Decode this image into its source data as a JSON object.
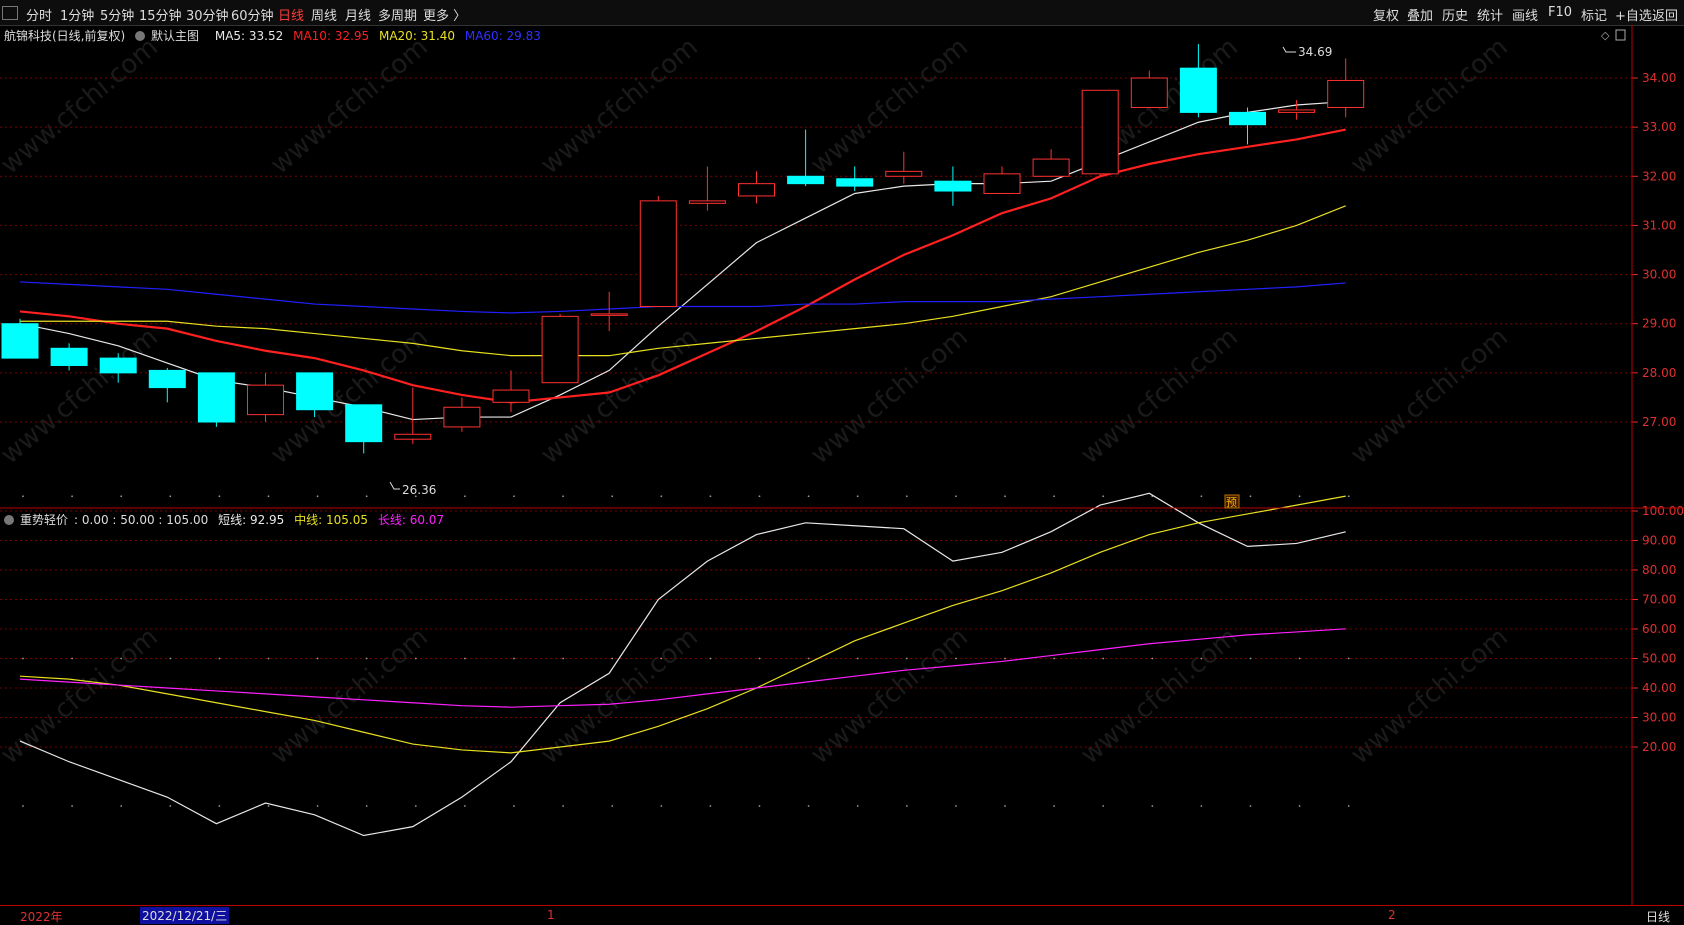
{
  "toolbar": {
    "left_items": [
      "分时",
      "1分钟",
      "5分钟",
      "15分钟",
      "30分钟",
      "60分钟",
      "日线",
      "周线",
      "月线",
      "多周期",
      "更多 〉"
    ],
    "active_item": "日线",
    "right_items": [
      "复权",
      "叠加",
      "历史",
      "统计",
      "画线",
      "F10",
      "标记",
      "+自选",
      "返回"
    ]
  },
  "main_chart": {
    "title": "航锦科技(日线,前复权)",
    "template": "默认主图",
    "ma5_label": "MA5: 33.52",
    "ma10_label": "MA10: 32.95",
    "ma20_label": "MA20: 31.40",
    "ma60_label": "MA60: 29.83",
    "high_label": "34.69",
    "low_label": "26.36",
    "predict_label": "预"
  },
  "sub_chart": {
    "title": "重势轻价",
    "levels_label": ": 0.00 : 50.00 : 105.00",
    "short_label": "短线: 92.95",
    "mid_label": "中线: 105.05",
    "long_label": "长线: 60.07"
  },
  "bottom_bar": {
    "year_label": "2022年",
    "date_label": "2022/12/21/三",
    "mark1": "1",
    "mark2": "2",
    "period_label": "日线"
  },
  "watermark": "www.cfchi.com",
  "colors": {
    "up": "#ff3030",
    "down": "#00ffff",
    "ma5": "#e8e8e8",
    "ma10": "#ff2020",
    "ma20": "#e8e020",
    "ma60": "#2020ff",
    "long": "#ff20ff",
    "grid": "#7a0000",
    "axis": "#e03030"
  },
  "chart_data": [
    {
      "type": "candlestick",
      "ylim": [
        26.0,
        35.0
      ],
      "yticks": [
        27.0,
        28.0,
        29.0,
        30.0,
        31.0,
        32.0,
        33.0,
        34.0
      ],
      "candles": [
        {
          "o": 29.0,
          "c": 28.3,
          "h": 29.1,
          "l": 28.3
        },
        {
          "o": 28.5,
          "c": 28.15,
          "h": 28.6,
          "l": 28.05
        },
        {
          "o": 28.3,
          "c": 28.0,
          "h": 28.4,
          "l": 27.8
        },
        {
          "o": 28.05,
          "c": 27.7,
          "h": 28.1,
          "l": 27.4
        },
        {
          "o": 28.0,
          "c": 27.0,
          "h": 28.0,
          "l": 26.9
        },
        {
          "o": 27.15,
          "c": 27.75,
          "h": 28.0,
          "l": 27.0
        },
        {
          "o": 28.0,
          "c": 27.25,
          "h": 28.0,
          "l": 27.1
        },
        {
          "o": 27.35,
          "c": 26.6,
          "h": 27.35,
          "l": 26.36
        },
        {
          "o": 26.65,
          "c": 26.75,
          "h": 27.7,
          "l": 26.55
        },
        {
          "o": 26.9,
          "c": 27.3,
          "h": 27.5,
          "l": 26.8
        },
        {
          "o": 27.4,
          "c": 27.65,
          "h": 28.05,
          "l": 27.2
        },
        {
          "o": 27.8,
          "c": 29.15,
          "h": 29.2,
          "l": 27.8
        },
        {
          "o": 29.2,
          "c": 29.2,
          "h": 29.65,
          "l": 28.85
        },
        {
          "o": 29.35,
          "c": 31.5,
          "h": 31.6,
          "l": 29.35
        },
        {
          "o": 31.45,
          "c": 31.5,
          "h": 32.2,
          "l": 31.3
        },
        {
          "o": 31.6,
          "c": 31.85,
          "h": 32.1,
          "l": 31.45
        },
        {
          "o": 32.0,
          "c": 31.85,
          "h": 32.95,
          "l": 31.8
        },
        {
          "o": 31.95,
          "c": 31.8,
          "h": 32.2,
          "l": 31.7
        },
        {
          "o": 32.0,
          "c": 32.1,
          "h": 32.5,
          "l": 31.85
        },
        {
          "o": 31.9,
          "c": 31.7,
          "h": 32.2,
          "l": 31.4
        },
        {
          "o": 31.65,
          "c": 32.05,
          "h": 32.2,
          "l": 31.65
        },
        {
          "o": 32.0,
          "c": 32.35,
          "h": 32.55,
          "l": 32.0
        },
        {
          "o": 32.05,
          "c": 33.75,
          "h": 33.75,
          "l": 32.0
        },
        {
          "o": 33.4,
          "c": 34.0,
          "h": 34.15,
          "l": 33.4
        },
        {
          "o": 34.2,
          "c": 33.3,
          "h": 34.69,
          "l": 33.2
        },
        {
          "o": 33.3,
          "c": 33.05,
          "h": 33.4,
          "l": 32.65
        },
        {
          "o": 33.3,
          "c": 33.35,
          "h": 33.55,
          "l": 33.15
        },
        {
          "o": 33.4,
          "c": 33.95,
          "h": 34.4,
          "l": 33.2
        }
      ],
      "series": [
        {
          "name": "MA5",
          "values": [
            29.0,
            28.8,
            28.55,
            28.2,
            27.85,
            27.7,
            27.5,
            27.3,
            27.05,
            27.1,
            27.1,
            27.55,
            28.05,
            28.95,
            29.8,
            30.65,
            31.15,
            31.65,
            31.8,
            31.85,
            31.85,
            31.9,
            32.3,
            32.7,
            33.1,
            33.3,
            33.45,
            33.52
          ]
        },
        {
          "name": "MA10",
          "values": [
            29.25,
            29.15,
            29.0,
            28.9,
            28.65,
            28.45,
            28.3,
            28.05,
            27.75,
            27.55,
            27.4,
            27.5,
            27.6,
            27.95,
            28.4,
            28.85,
            29.35,
            29.9,
            30.4,
            30.8,
            31.25,
            31.55,
            32.0,
            32.25,
            32.45,
            32.6,
            32.75,
            32.95
          ]
        },
        {
          "name": "MA20",
          "values": [
            29.05,
            29.05,
            29.05,
            29.05,
            28.95,
            28.9,
            28.8,
            28.7,
            28.6,
            28.45,
            28.35,
            28.35,
            28.35,
            28.5,
            28.6,
            28.7,
            28.8,
            28.9,
            29.0,
            29.15,
            29.35,
            29.55,
            29.85,
            30.15,
            30.45,
            30.7,
            31.0,
            31.4
          ]
        },
        {
          "name": "MA60",
          "values": [
            29.85,
            29.8,
            29.75,
            29.7,
            29.6,
            29.5,
            29.4,
            29.35,
            29.3,
            29.25,
            29.22,
            29.25,
            29.3,
            29.35,
            29.35,
            29.35,
            29.4,
            29.4,
            29.45,
            29.45,
            29.45,
            29.5,
            29.55,
            29.6,
            29.65,
            29.7,
            29.75,
            29.83
          ]
        }
      ]
    },
    {
      "type": "line",
      "title": "重势轻价",
      "ylim": [
        -35,
        110
      ],
      "yticks": [
        20,
        30,
        40,
        50,
        60,
        70,
        80,
        90,
        100
      ],
      "series": [
        {
          "name": "短线",
          "values": [
            22,
            15,
            9,
            3,
            -6,
            1,
            -3,
            -10,
            -7,
            3,
            15,
            35,
            45,
            70,
            83,
            92,
            96,
            95,
            94,
            83,
            86,
            93,
            102,
            106,
            96,
            88,
            89,
            92.95
          ]
        },
        {
          "name": "中线",
          "values": [
            44,
            43,
            41,
            38,
            35,
            32,
            29,
            25,
            21,
            19,
            18,
            20,
            22,
            27,
            33,
            40,
            48,
            56,
            62,
            68,
            73,
            79,
            86,
            92,
            96,
            99,
            102,
            105.05
          ]
        },
        {
          "name": "长线",
          "values": [
            43,
            42,
            41,
            40,
            39,
            38,
            37,
            36,
            35,
            34,
            33.5,
            34,
            34.5,
            36,
            38,
            40,
            42,
            44,
            46,
            47.5,
            49,
            51,
            53,
            55,
            56.5,
            58,
            59,
            60.07
          ]
        }
      ]
    }
  ]
}
